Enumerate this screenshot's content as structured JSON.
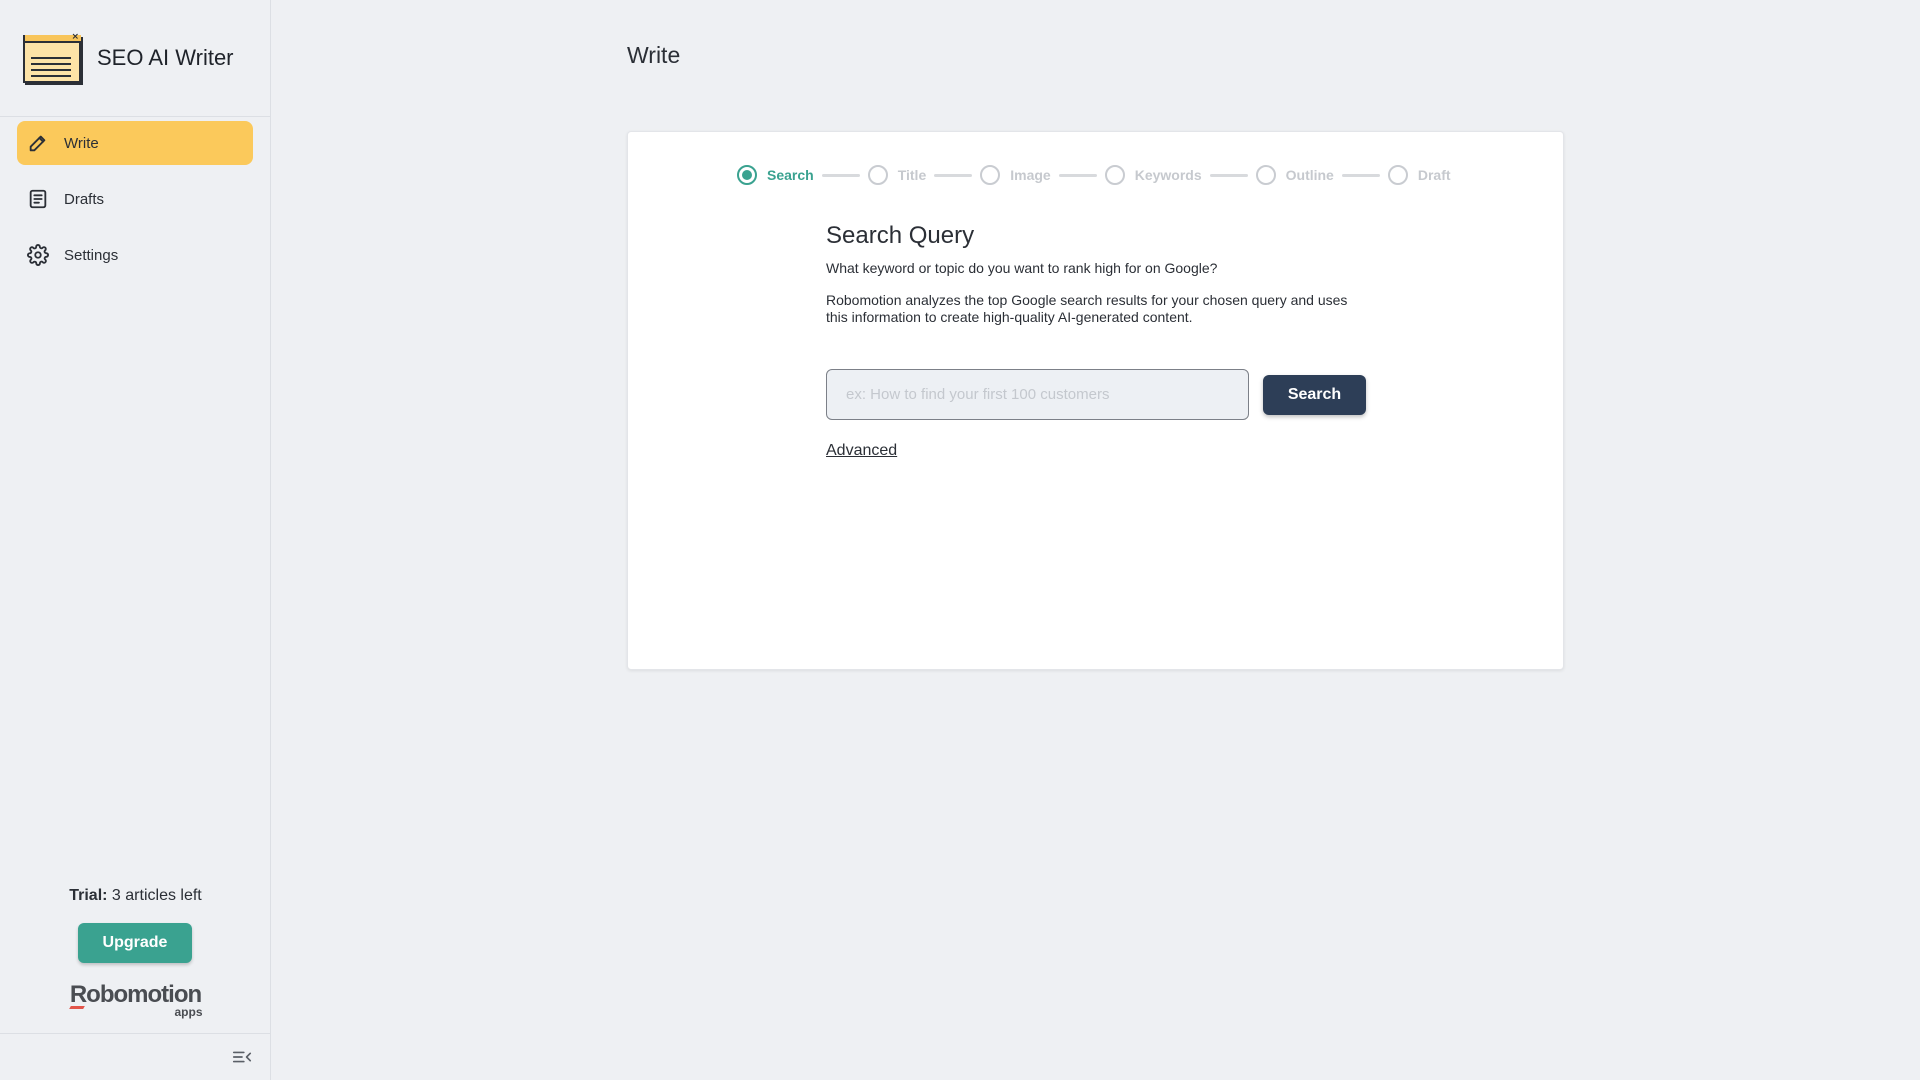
{
  "app": {
    "title": "SEO AI Writer"
  },
  "sidebar": {
    "items": [
      {
        "label": "Write",
        "icon": "pencil-icon",
        "active": true
      },
      {
        "label": "Drafts",
        "icon": "document-icon",
        "active": false
      },
      {
        "label": "Settings",
        "icon": "gear-icon",
        "active": false
      }
    ],
    "trial_label": "Trial:",
    "trial_count": "3",
    "trial_suffix": "articles left",
    "upgrade_label": "Upgrade",
    "logo_text": "Robomotion",
    "logo_sub": "apps"
  },
  "main": {
    "page_title": "Write",
    "stepper": [
      {
        "label": "Search",
        "active": true
      },
      {
        "label": "Title",
        "active": false
      },
      {
        "label": "Image",
        "active": false
      },
      {
        "label": "Keywords",
        "active": false
      },
      {
        "label": "Outline",
        "active": false
      },
      {
        "label": "Draft",
        "active": false
      }
    ],
    "section_title": "Search Query",
    "question": "What keyword or topic do you want to rank high for on Google?",
    "description": "Robomotion analyzes the top Google search results for your chosen query and uses this information to create high-quality AI-generated content.",
    "search": {
      "placeholder": "ex: How to find your first 100 customers",
      "value": "",
      "button_label": "Search"
    },
    "advanced_label": "Advanced"
  },
  "colors": {
    "accent": "#3aa290",
    "active_nav": "#fbc95b",
    "primary_button": "#2d3e57",
    "background": "#eef0f3"
  }
}
